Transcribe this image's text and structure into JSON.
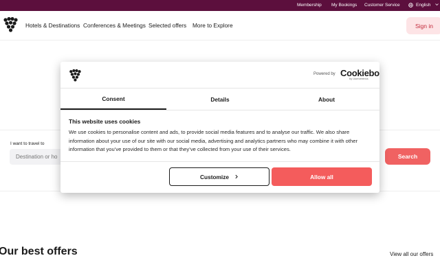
{
  "topbar": {
    "membership": "Membership",
    "bookings": "My Bookings",
    "customer_service": "Customer Service",
    "language": "English"
  },
  "nav": {
    "links": [
      "Hotels & Destinations",
      "Conferences & Meetings",
      "Selected offers",
      "More to Explore"
    ],
    "signin": "Sign in"
  },
  "search": {
    "label": "I want to travel to",
    "placeholder": "Destination or ho",
    "button": "Search"
  },
  "offers": {
    "heading": "Our best offers",
    "view_all": "View all our offers"
  },
  "cookie_modal": {
    "powered_by": "Powered by",
    "cookiebot": "Cookiebot",
    "cookiebot_sub": "by Usercentrics",
    "tabs": [
      "Consent",
      "Details",
      "About"
    ],
    "active_tab": "Consent",
    "heading": "This website uses cookies",
    "body": "We use cookies to personalise content and ads, to provide social media features and to analyse our traffic. We also share information about your use of our site with our social media, advertising and analytics partners who may combine it with other information that you’ve provided to them or that they’ve collected from your use of their services.",
    "customize": "Customize",
    "allow_all": "Allow all"
  },
  "colors": {
    "topbar": "#5c0f3d",
    "accent": "#f45c5c",
    "signin_bg": "#fde4e6"
  }
}
